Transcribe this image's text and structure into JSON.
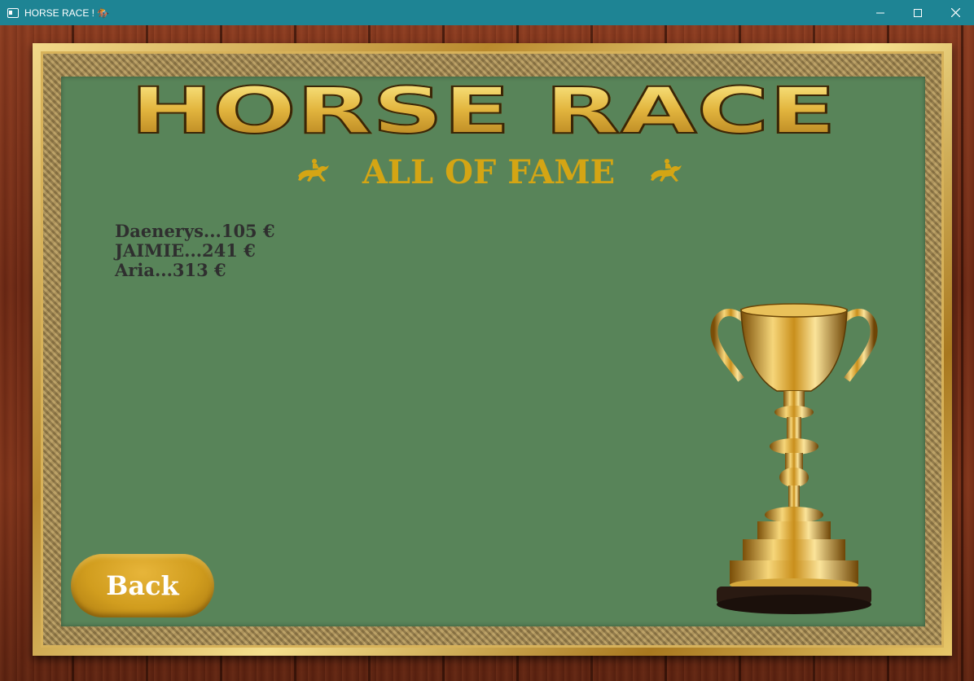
{
  "window": {
    "title": "HORSE RACE ! 🏇"
  },
  "game": {
    "logo_text": "HORSE RACE",
    "subtitle": "ALL OF FAME",
    "hall_of_fame": [
      "Daenerys...105 €",
      "JAIMIE...241 €",
      "Aria...313 €"
    ],
    "back_label": "Back"
  },
  "colors": {
    "titlebar": "#1e8494",
    "felt": "#588459",
    "gold": "#d4a514",
    "score_text": "#2f2f2f"
  }
}
